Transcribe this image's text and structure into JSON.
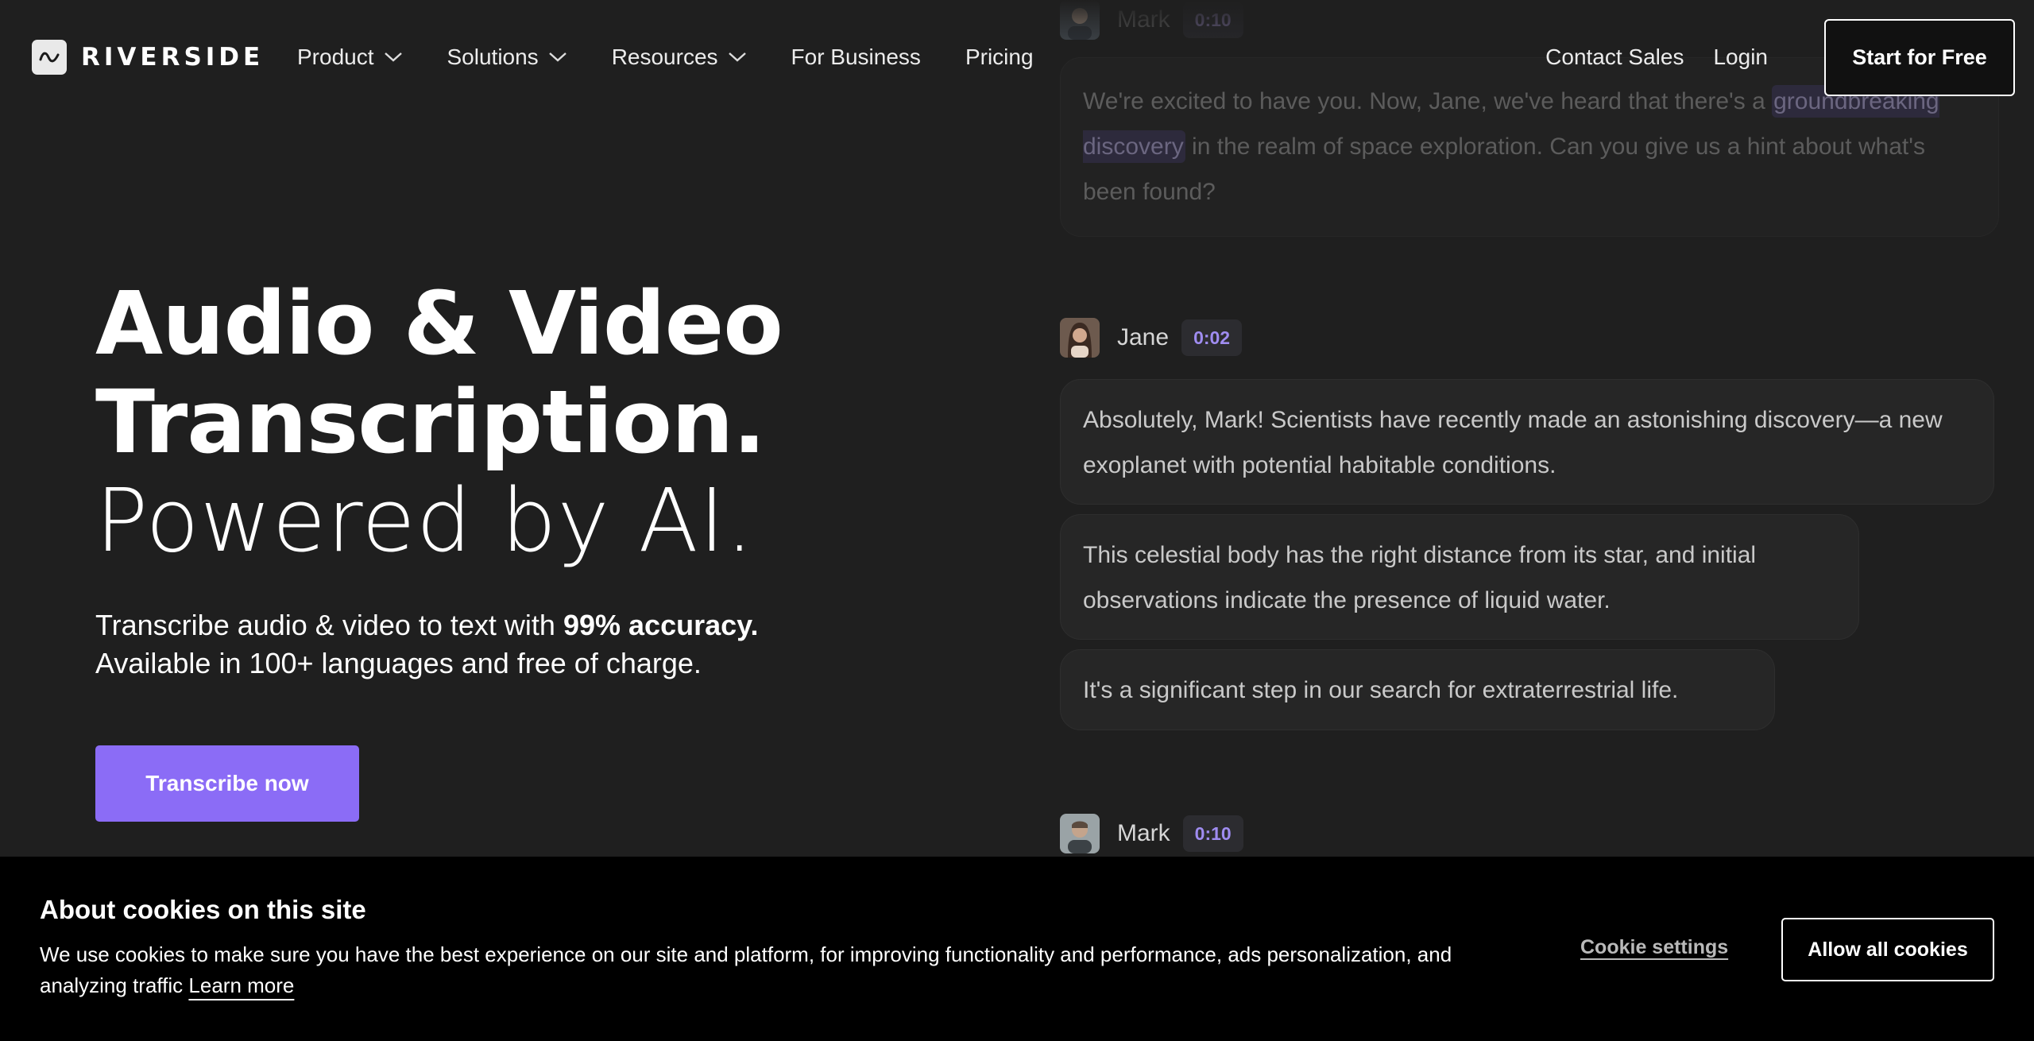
{
  "brand": {
    "name": "RIVERSIDE",
    "logo_icon": "riverside-wave-icon"
  },
  "nav": {
    "items": [
      {
        "label": "Product",
        "has_dropdown": true
      },
      {
        "label": "Solutions",
        "has_dropdown": true
      },
      {
        "label": "Resources",
        "has_dropdown": true
      },
      {
        "label": "For Business",
        "has_dropdown": false
      },
      {
        "label": "Pricing",
        "has_dropdown": false
      }
    ],
    "contact_sales": "Contact Sales",
    "login": "Login",
    "start_free": "Start for Free"
  },
  "hero": {
    "line1": "Audio & Video",
    "line2": "Transcription.",
    "line3": "Powered by AI.",
    "sub_prefix": "Transcribe audio & video to text with ",
    "sub_bold": "99% accuracy.",
    "sub_line2": "Available in 100+ languages and free of charge.",
    "cta": "Transcribe now"
  },
  "transcript": {
    "messages": [
      {
        "speaker": "Mark",
        "time": "0:10",
        "bubble_parts": [
          "We're excited to have you. Now, Jane, we've heard that there's a ",
          "groundbreaking discovery",
          " in the realm of space exploration. Can you give us a hint about what's been found?"
        ]
      },
      {
        "speaker": "Jane",
        "time": "0:02",
        "bubbles": [
          "Absolutely, Mark! Scientists have recently made an astonishing discovery—a new exoplanet with potential habitable conditions.",
          " This celestial body has the right distance from its star, and initial observations indicate the presence of liquid water.",
          " It's a significant step in our search for extraterrestrial life."
        ]
      },
      {
        "speaker": "Mark",
        "time": "0:10"
      }
    ]
  },
  "cookie": {
    "title": "About cookies on this site",
    "text": "We use cookies to make sure you have the best experience on our site and platform, for improving functionality and performance, ads personalization, and analyzing traffic ",
    "learn_more": "Learn more",
    "settings": "Cookie settings",
    "allow": "Allow all cookies"
  },
  "colors": {
    "background": "#1f1f1f",
    "accent": "#8b6cf6",
    "time_badge_text": "#9f8cf0",
    "cookie_bg": "#000000"
  }
}
